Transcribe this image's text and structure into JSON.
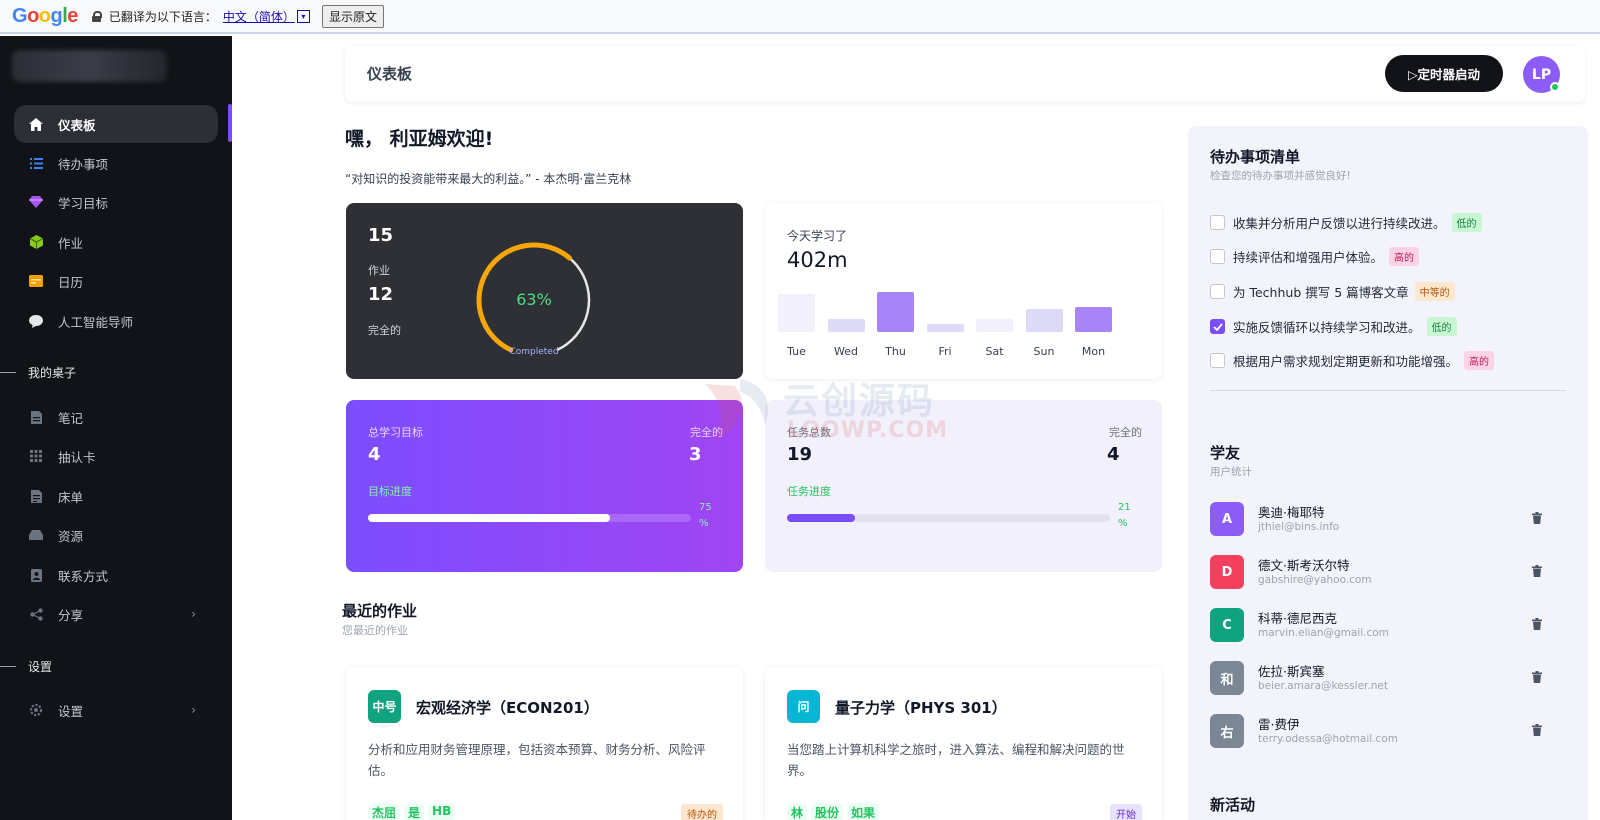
{
  "translate_bar": {
    "logo": "Google",
    "translated_to_label": "已翻译为以下语言：",
    "language": "中文（简体）",
    "dropdown_glyph": "▾",
    "show_original_label": "显示原文"
  },
  "sidebar": {
    "items": [
      {
        "label": "仪表板",
        "icon": "home-icon",
        "active": true
      },
      {
        "label": "待办事项",
        "icon": "list-icon"
      },
      {
        "label": "学习目标",
        "icon": "diamond-icon"
      },
      {
        "label": "作业",
        "icon": "cube-icon"
      },
      {
        "label": "日历",
        "icon": "calendar-icon"
      },
      {
        "label": "人工智能导师",
        "icon": "chat-icon"
      }
    ],
    "section_desk": "我的桌子",
    "desk_items": [
      {
        "label": "笔记",
        "icon": "note-icon"
      },
      {
        "label": "抽认卡",
        "icon": "grid-icon"
      },
      {
        "label": "床单",
        "icon": "sheet-icon"
      },
      {
        "label": "资源",
        "icon": "drive-icon"
      },
      {
        "label": "联系方式",
        "icon": "contact-icon"
      },
      {
        "label": "分享",
        "icon": "share-icon"
      }
    ],
    "section_settings": "设置",
    "settings_item": {
      "label": "设置",
      "icon": "gear-icon"
    }
  },
  "header": {
    "title": "仪表板",
    "timer_button": "▷定时器启动",
    "avatar_initials": "LP"
  },
  "greeting": "嘿， 利亚姆欢迎!",
  "quote": "“对知识的投资能带来最大的利益。” - 本杰明·富兰克林",
  "assignments_card": {
    "total": "15",
    "total_label": "作业",
    "completed": "12",
    "completed_label": "完全的",
    "percent": 63,
    "percent_label": "63%",
    "ring_caption": "Completed"
  },
  "today_card": {
    "label": "今天学习了",
    "value": "402m",
    "bars": [
      {
        "day": "Tue",
        "level": 0.85,
        "tone": "faint"
      },
      {
        "day": "Wed",
        "level": 0.28,
        "tone": "light"
      },
      {
        "day": "Thu",
        "level": 0.88,
        "tone": "strong"
      },
      {
        "day": "Fri",
        "level": 0.18,
        "tone": "light"
      },
      {
        "day": "Sat",
        "level": 0.28,
        "tone": "faint"
      },
      {
        "day": "Sun",
        "level": 0.5,
        "tone": "light"
      },
      {
        "day": "Mon",
        "level": 0.55,
        "tone": "strong"
      }
    ]
  },
  "goals_card": {
    "total_label": "总学习目标",
    "total": "4",
    "completed_label": "完全的",
    "completed": "3",
    "progress_label": "目标进度",
    "progress": 0.75,
    "progress_text_top": "75",
    "progress_text_bottom": "%"
  },
  "tasks_card": {
    "total_label": "任务总数",
    "total": "19",
    "completed_label": "完全的",
    "completed": "4",
    "progress_label": "任务进度",
    "progress": 0.21,
    "progress_text_top": "21",
    "progress_text_bottom": "%"
  },
  "watermark": {
    "cn": "云创源码",
    "en": "LOOWP.COM"
  },
  "recent": {
    "title": "最近的作业",
    "subtitle": "您最近的作业",
    "cards": [
      {
        "icon_text": "中号",
        "icon_color": "#10a37f",
        "title": "宏观经济学（ECON201）",
        "desc": "分析和应用财务管理原理，包括资本预算、财务分析、风险评估。",
        "chips": [
          "杰屈",
          "是",
          "HB"
        ],
        "tag": "待办的",
        "tag_bg": "#fde8cf",
        "tag_color": "#b45309"
      },
      {
        "icon_text": "问",
        "icon_color": "#06b6d4",
        "title": "量子力学（PHYS 301）",
        "desc": "当您踏上计算机科学之旅时，进入算法、编程和解决问题的世界。",
        "chips": [
          "林",
          "股份",
          "如果"
        ],
        "tag": "开始",
        "tag_bg": "#e6e2fb",
        "tag_color": "#6d28d9"
      }
    ]
  },
  "todo_panel": {
    "title": "待办事项清单",
    "subtitle": "检查您的待办事项并感觉良好!",
    "items": [
      {
        "text": "收集并分析用户反馈以进行持续改进。",
        "priority": "低的",
        "level": "low",
        "checked": false
      },
      {
        "text": "持续评估和增强用户体验。",
        "priority": "高的",
        "level": "high",
        "checked": false
      },
      {
        "text": "为 Techhub 撰写 5 篇博客文章",
        "priority": "中等的",
        "level": "mid",
        "checked": false
      },
      {
        "text": "实施反馈循环以持续学习和改进。",
        "priority": "低的",
        "level": "low",
        "checked": true
      },
      {
        "text": "根据用户需求规划定期更新和功能增强。",
        "priority": "高的",
        "level": "high",
        "checked": false
      }
    ]
  },
  "friends_panel": {
    "title": "学友",
    "subtitle": "用户统计",
    "friends": [
      {
        "initial": "A",
        "color": "#8b5cf6",
        "name": "奥迪·梅耶特",
        "email": "jthiel@bins.info"
      },
      {
        "initial": "D",
        "color": "#f43f5e",
        "name": "德文·斯考沃尔特",
        "email": "gabshire@yahoo.com"
      },
      {
        "initial": "C",
        "color": "#10a37f",
        "name": "科蒂·德尼西克",
        "email": "marvin.elian@gmail.com"
      },
      {
        "initial": "和",
        "color": "#7b8794",
        "name": "佐拉·斯宾塞",
        "email": "beier.amara@kessler.net"
      },
      {
        "initial": "右",
        "color": "#7b8794",
        "name": "雷·费伊",
        "email": "terry.odessa@hotmail.com"
      }
    ]
  },
  "activity_title": "新活动",
  "colors": {
    "accent": "#7c4dff",
    "ring_fill": "#f5a70a",
    "ring_track": "#e5e7eb",
    "bar_strong": "#a884f9",
    "bar_light": "#dcdaf7",
    "bar_faint": "#f1f0fb"
  }
}
